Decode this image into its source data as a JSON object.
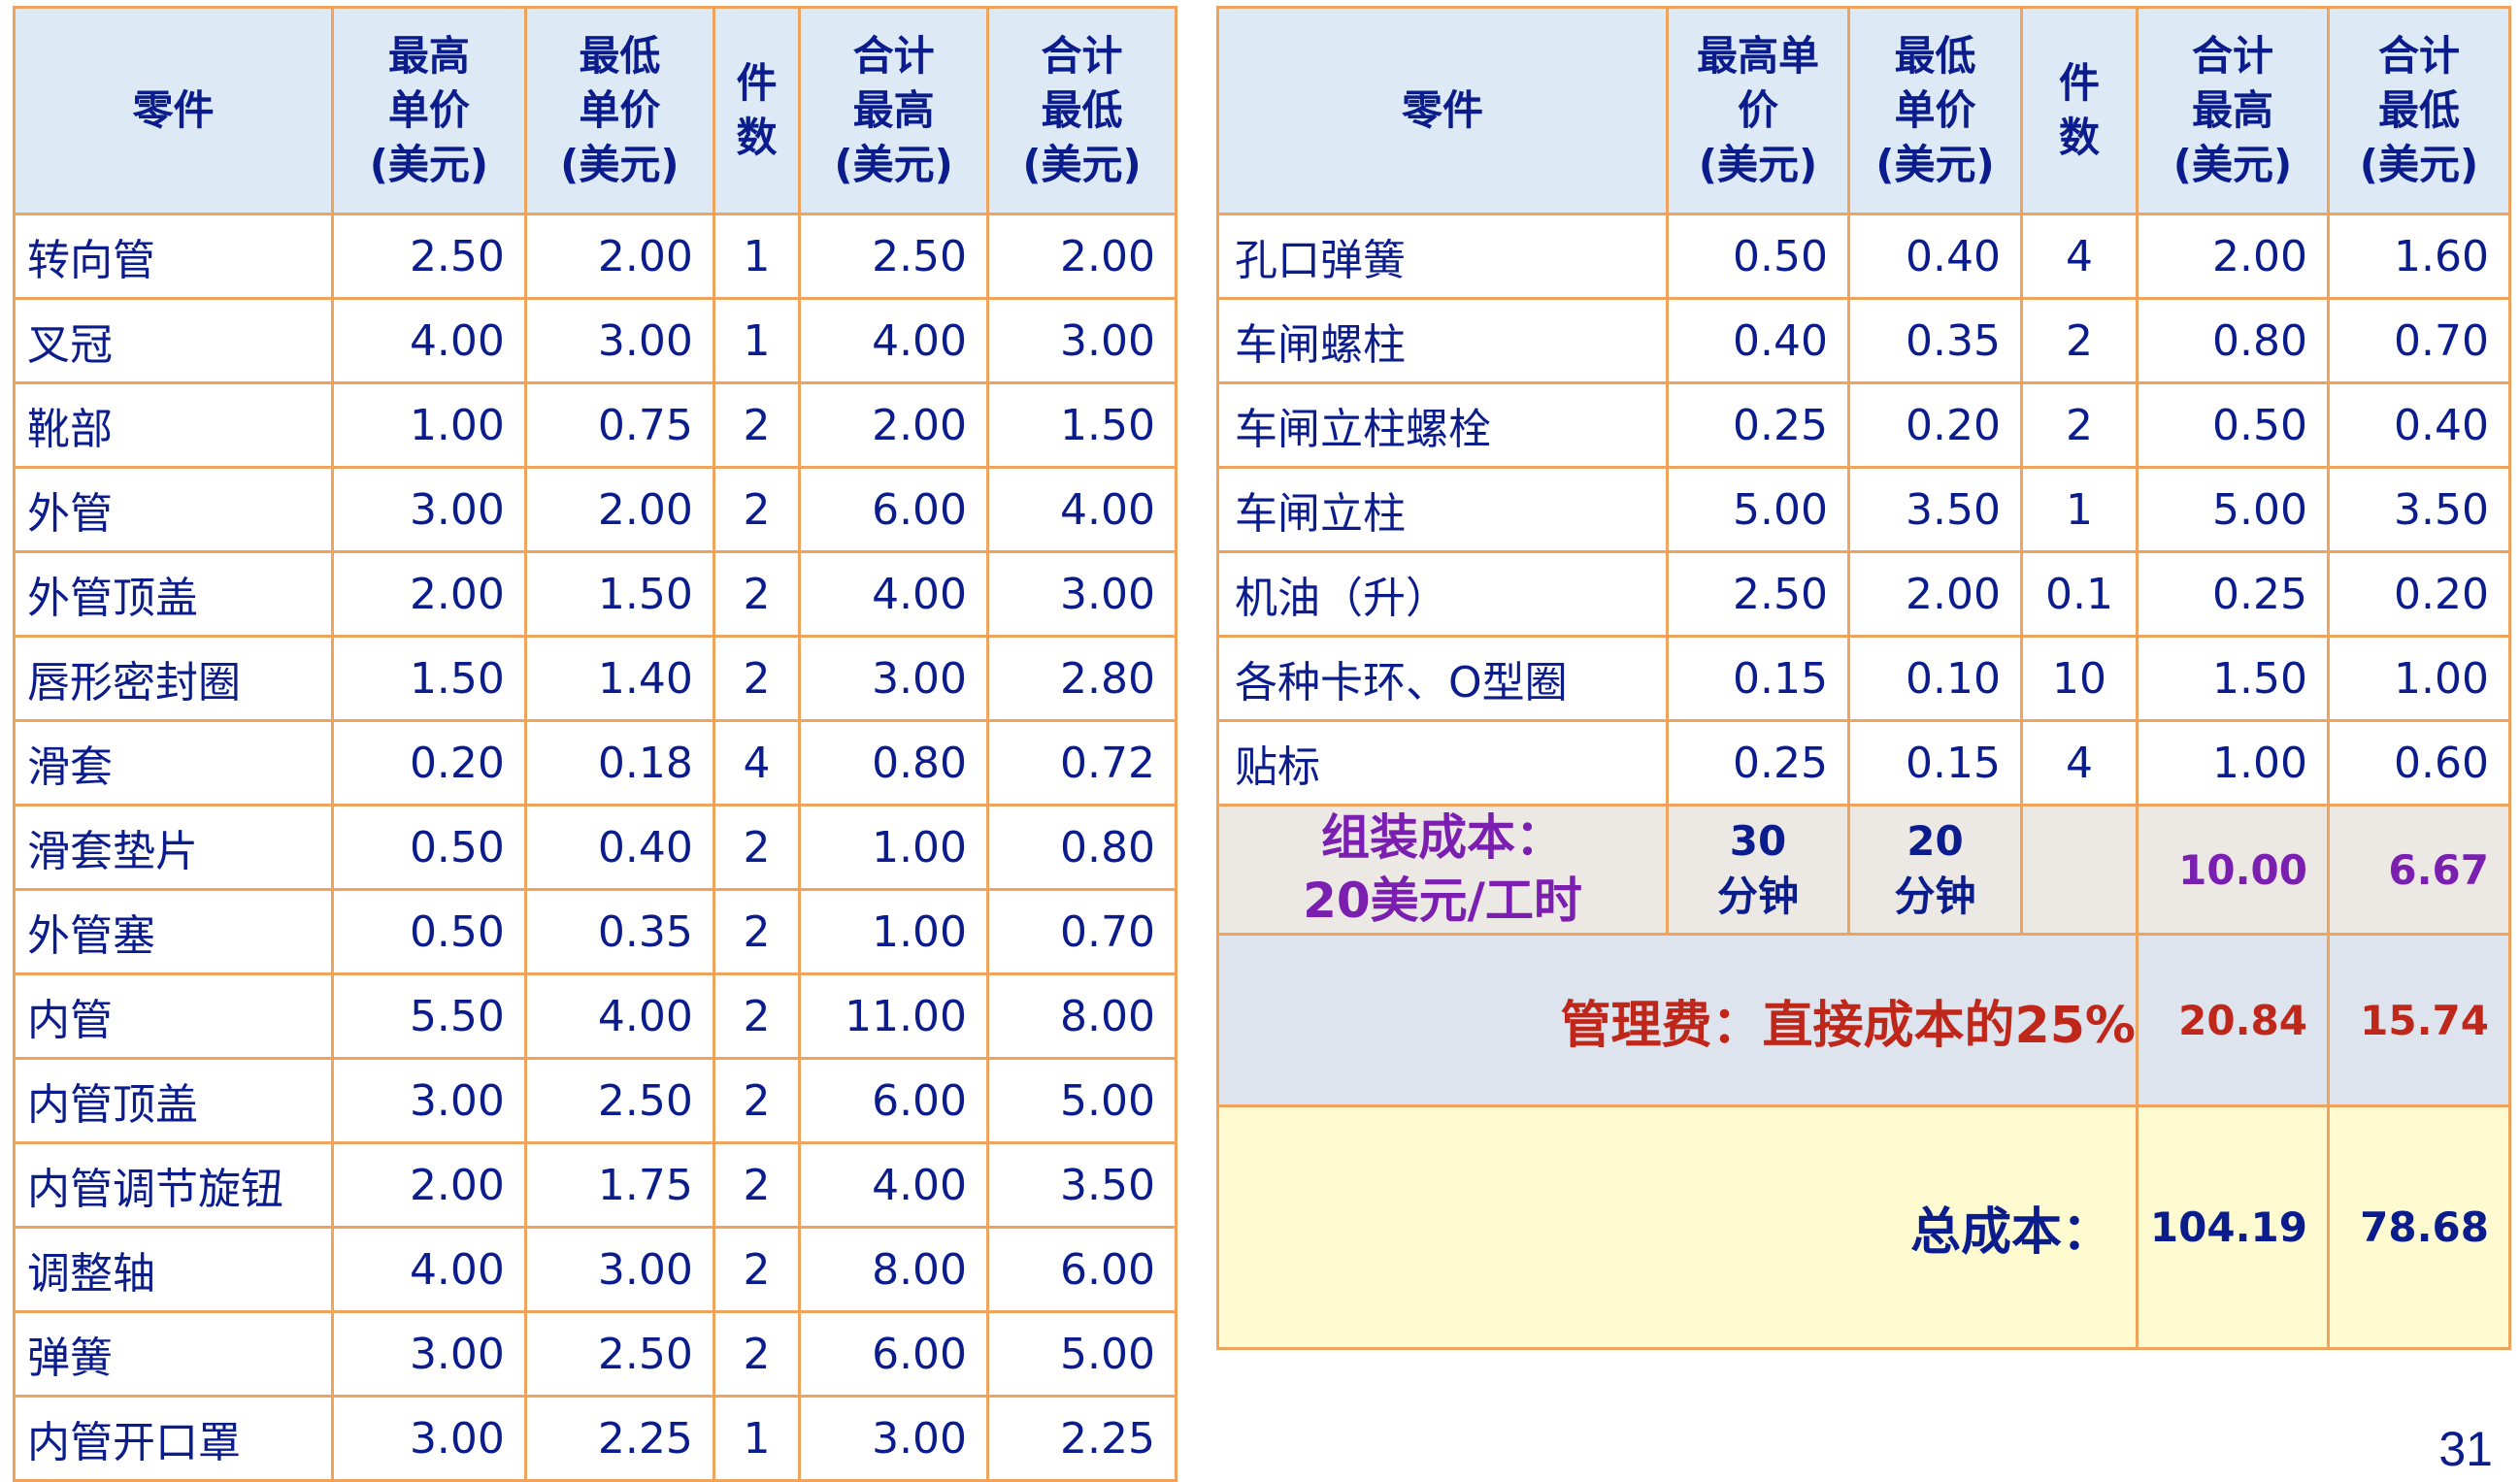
{
  "left_table": {
    "headers": [
      "零件",
      "最高\n单价\n(美元)",
      "最低\n单价\n(美元)",
      "件\n数",
      "合计\n最高\n(美元)",
      "合计\n最低\n(美元)"
    ],
    "rows": [
      [
        "转向管",
        "2.50",
        "2.00",
        "1",
        "2.50",
        "2.00"
      ],
      [
        "叉冠",
        "4.00",
        "3.00",
        "1",
        "4.00",
        "3.00"
      ],
      [
        "靴部",
        "1.00",
        "0.75",
        "2",
        "2.00",
        "1.50"
      ],
      [
        "外管",
        "3.00",
        "2.00",
        "2",
        "6.00",
        "4.00"
      ],
      [
        "外管顶盖",
        "2.00",
        "1.50",
        "2",
        "4.00",
        "3.00"
      ],
      [
        "唇形密封圈",
        "1.50",
        "1.40",
        "2",
        "3.00",
        "2.80"
      ],
      [
        "滑套",
        "0.20",
        "0.18",
        "4",
        "0.80",
        "0.72"
      ],
      [
        "滑套垫片",
        "0.50",
        "0.40",
        "2",
        "1.00",
        "0.80"
      ],
      [
        "外管塞",
        "0.50",
        "0.35",
        "2",
        "1.00",
        "0.70"
      ],
      [
        "内管",
        "5.50",
        "4.00",
        "2",
        "11.00",
        "8.00"
      ],
      [
        "内管顶盖",
        "3.00",
        "2.50",
        "2",
        "6.00",
        "5.00"
      ],
      [
        "内管调节旋钮",
        "2.00",
        "1.75",
        "2",
        "4.00",
        "3.50"
      ],
      [
        "调整轴",
        "4.00",
        "3.00",
        "2",
        "8.00",
        "6.00"
      ],
      [
        "弹簧",
        "3.00",
        "2.50",
        "2",
        "6.00",
        "5.00"
      ],
      [
        "内管开口罩",
        "3.00",
        "2.25",
        "1",
        "3.00",
        "2.25"
      ]
    ]
  },
  "right_table": {
    "headers": [
      "零件",
      "最高单\n价\n(美元)",
      "最低\n单价\n(美元)",
      "件\n数",
      "合计\n最高\n(美元)",
      "合计\n最低\n(美元)"
    ],
    "rows": [
      [
        "孔口弹簧",
        "0.50",
        "0.40",
        "4",
        "2.00",
        "1.60"
      ],
      [
        "车闸螺柱",
        "0.40",
        "0.35",
        "2",
        "0.80",
        "0.70"
      ],
      [
        "车闸立柱螺栓",
        "0.25",
        "0.20",
        "2",
        "0.50",
        "0.40"
      ],
      [
        "车闸立柱",
        "5.00",
        "3.50",
        "1",
        "5.00",
        "3.50"
      ],
      [
        "机油（升）",
        "2.50",
        "2.00",
        "0.1",
        "0.25",
        "0.20"
      ],
      [
        "各种卡环、O型圈",
        "0.15",
        "0.10",
        "10",
        "1.50",
        "1.00"
      ],
      [
        "贴标",
        "0.25",
        "0.15",
        "4",
        "1.00",
        "0.60"
      ]
    ],
    "assembly": {
      "label": "组装成本：\n20美元/工时",
      "max_time": "30\n分钟",
      "min_time": "20\n分钟",
      "total_max": "10.00",
      "total_min": "6.67"
    },
    "overhead": {
      "label": "管理费：直接成本的25%",
      "total_max": "20.84",
      "total_min": "15.74"
    },
    "total": {
      "label": "总成本：",
      "total_max": "104.19",
      "total_min": "78.68"
    }
  },
  "page_number": "31",
  "colors": {
    "border": "#f0a35c",
    "header_bg": "#dde9f4",
    "text": "#0b1c8c",
    "assembly_text": "#7a1fb0",
    "overhead_text": "#c0271b",
    "total_bg": "#fdfbcf"
  }
}
